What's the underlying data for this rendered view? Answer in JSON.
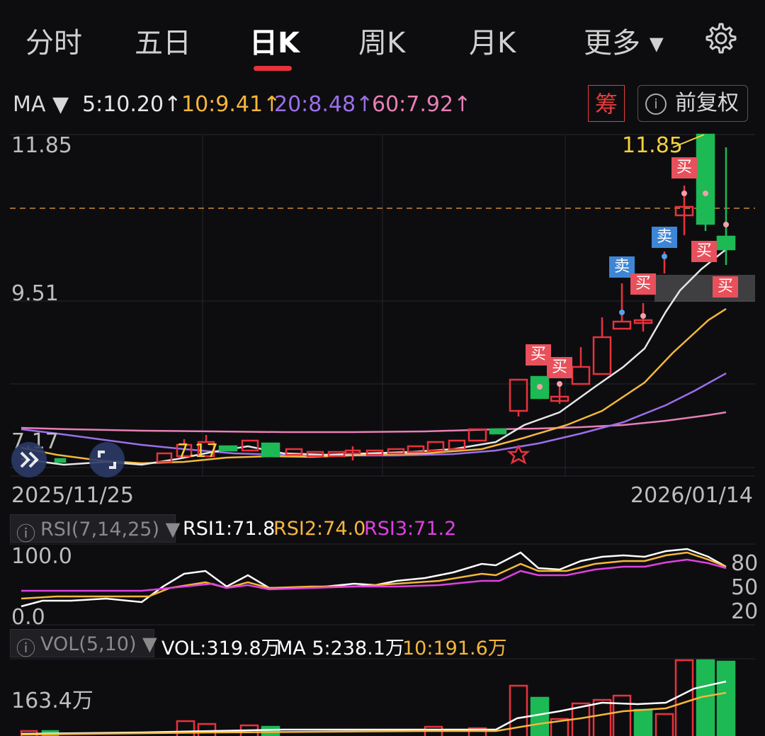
{
  "tabs": [
    {
      "label": "分时"
    },
    {
      "label": "五日"
    },
    {
      "label": "日K",
      "active": true
    },
    {
      "label": "周K"
    },
    {
      "label": "月K"
    },
    {
      "label": "更多 ▾"
    }
  ],
  "settings_icon": "gear-icon",
  "ma_bar": {
    "label": "MA ▼",
    "ma5": "5:10.20↑",
    "ma10": "10:9.41↑",
    "ma20": "20:8.48↑",
    "ma60": "60:7.92↑",
    "chip_button": "筹",
    "adjust_button": "前复权",
    "colors": {
      "ma5": "#e0e0e0",
      "ma10": "#f5b73b",
      "ma20": "#9b6fe8",
      "ma60": "#e87fb5",
      "up": "#e8323c",
      "down": "#1db954"
    }
  },
  "price_axis": {
    "high": "11.85",
    "mid": "9.51",
    "low": "7.17"
  },
  "date_axis": {
    "start": "2025/11/25",
    "end": "2026/01/14"
  },
  "annotations": {
    "max_label": "11.85",
    "low_label": "7.17",
    "buy": "买",
    "sell": "卖"
  },
  "rsi": {
    "selector": "RSI(7,14,25) ▼",
    "rsi1": "RSI1:71.8",
    "rsi2": "RSI2:74.0",
    "rsi3": "RSI3:71.2",
    "axis_top": "100.0",
    "axis_bottom": "0.0",
    "levels": [
      "80",
      "50",
      "20"
    ]
  },
  "vol": {
    "selector": "VOL(5,10) ▼",
    "vol": "VOL:319.8万",
    "ma5": "MA 5:238.1万",
    "ma10": "10:191.6万",
    "axis": "163.4万"
  }
}
